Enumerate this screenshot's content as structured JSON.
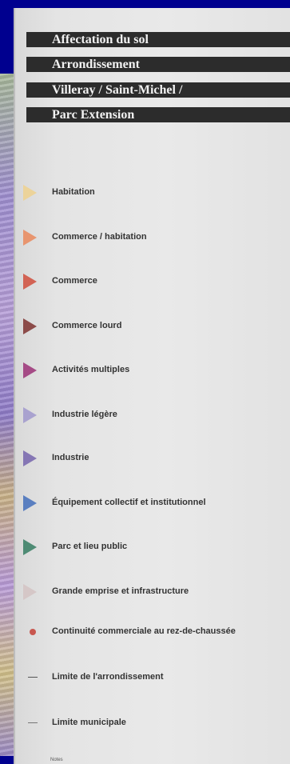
{
  "title_lines": [
    "Affectation du sol",
    "Arrondissement",
    "Villeray / Saint-Michel /",
    "Parc Extension"
  ],
  "legend": [
    {
      "label": "Habitation",
      "marker": "triangle",
      "color": "#ecd39a"
    },
    {
      "label": "Commerce / habitation",
      "marker": "triangle",
      "color": "#e8956f"
    },
    {
      "label": "Commerce",
      "marker": "triangle",
      "color": "#d26354"
    },
    {
      "label": "Commerce lourd",
      "marker": "triangle",
      "color": "#8c4b49"
    },
    {
      "label": "Activités multiples",
      "marker": "triangle",
      "color": "#a54b86"
    },
    {
      "label": "Industrie légère",
      "marker": "triangle",
      "color": "#a9a2cf"
    },
    {
      "label": "Industrie",
      "marker": "triangle",
      "color": "#8576b4"
    },
    {
      "label": "Équipement collectif et institutionnel",
      "marker": "triangle",
      "color": "#5a7fc0"
    },
    {
      "label": "Parc et lieu public",
      "marker": "triangle",
      "color": "#4e8b74"
    },
    {
      "label": "Grande emprise et infrastructure",
      "marker": "triangle",
      "color": "#d5c7c7"
    },
    {
      "label": "Continuité commerciale au rez-de-chaussée",
      "marker": "dot",
      "color": "#c8574f"
    },
    {
      "label": "Limite de l'arrondissement",
      "marker": "dash",
      "color": "#555555"
    },
    {
      "label": "Limite municipale",
      "marker": "dash",
      "color": "#777777"
    }
  ],
  "notes_label": "Notes"
}
